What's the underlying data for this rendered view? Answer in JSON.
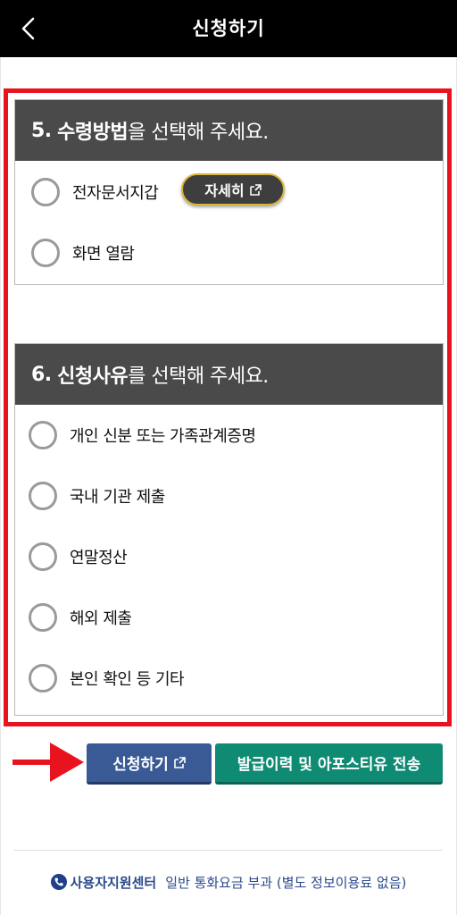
{
  "header": {
    "title": "신청하기",
    "back_icon": "chevron-left-icon"
  },
  "section5": {
    "number": "5.",
    "bold": "수령방법",
    "rest": "을 선택해 주세요.",
    "options": [
      {
        "label": "전자문서지갑",
        "selected": false
      },
      {
        "label": "화면 열람",
        "selected": false
      }
    ],
    "detail_button": {
      "label": "자세히",
      "icon": "external-link-icon"
    }
  },
  "section6": {
    "number": "6.",
    "bold": "신청사유",
    "rest": "를 선택해 주세요.",
    "options": [
      {
        "label": "개인 신분 또는 가족관계증명",
        "selected": false
      },
      {
        "label": "국내 기관 제출",
        "selected": false
      },
      {
        "label": "연말정산",
        "selected": false
      },
      {
        "label": "해외 제출",
        "selected": false
      },
      {
        "label": "본인 확인 등 기타",
        "selected": false
      }
    ]
  },
  "actions": {
    "apply_label": "신청하기",
    "history_label": "발급이력 및 아포스티유 전송"
  },
  "footer": {
    "support_label": "사용자지원센터",
    "fee_note": "일반 통화요금 부과 (별도 정보이용료 없음)",
    "icon": "phone-icon"
  },
  "colors": {
    "highlight_frame": "#e8131f",
    "apply_button": "#3a5a96",
    "history_button": "#0f8a73",
    "section_header": "#4a4a4a",
    "arrow": "#e8131f"
  }
}
